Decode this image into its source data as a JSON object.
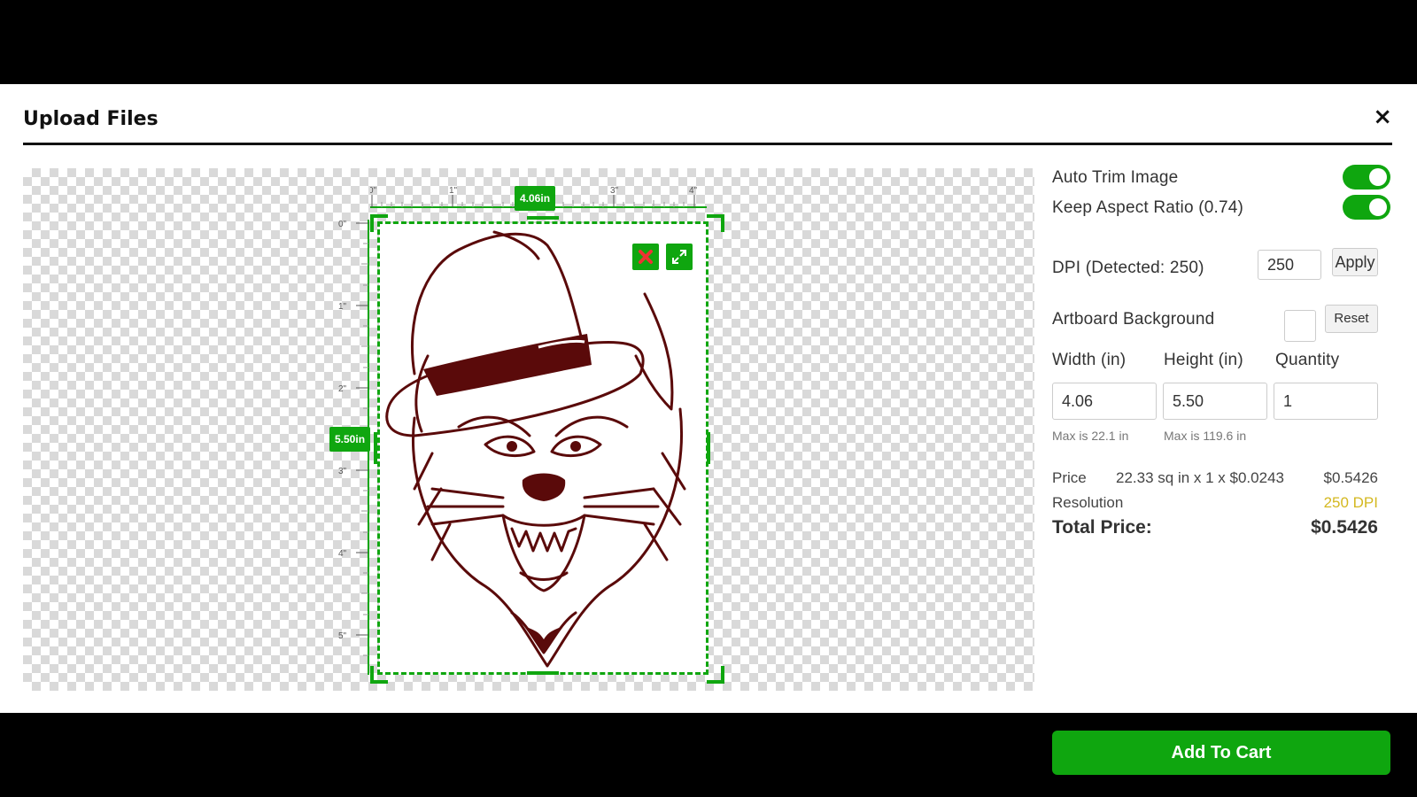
{
  "modal": {
    "title": "Upload Files",
    "close_label": "×"
  },
  "canvas": {
    "width_badge": "4.06in",
    "height_badge": "5.50in",
    "ruler_x": [
      "0\"",
      "1\"",
      "2\"",
      "3\"",
      "4\""
    ],
    "ruler_y": [
      "0\"",
      "1\"",
      "2\"",
      "3\"",
      "4\"",
      "5\""
    ]
  },
  "settings": {
    "auto_trim": {
      "label": "Auto Trim Image",
      "on": true
    },
    "keep_aspect": {
      "label": "Keep Aspect Ratio (0.74)",
      "on": true
    },
    "dpi": {
      "label": "DPI (Detected: 250)",
      "value": "250",
      "apply_label": "Apply"
    },
    "artboard": {
      "label": "Artboard Background",
      "reset_label": "Reset"
    },
    "width": {
      "label": "Width (in)",
      "value": "4.06",
      "hint": "Max is 22.1 in"
    },
    "height": {
      "label": "Height (in)",
      "value": "5.50",
      "hint": "Max is 119.6 in"
    },
    "quantity": {
      "label": "Quantity",
      "value": "1"
    }
  },
  "pricing": {
    "price_label": "Price",
    "price_formula": "22.33 sq in x 1 x $0.0243",
    "price_value": "$0.5426",
    "resolution_label": "Resolution",
    "resolution_value": "250 DPI",
    "total_label": "Total Price:",
    "total_value": "$0.5426"
  },
  "cart": {
    "button_label": "Add To Cart"
  },
  "colors": {
    "accent": "#0fa60f",
    "resolution": "#d4b820",
    "artwork": "#5a0a0a"
  }
}
